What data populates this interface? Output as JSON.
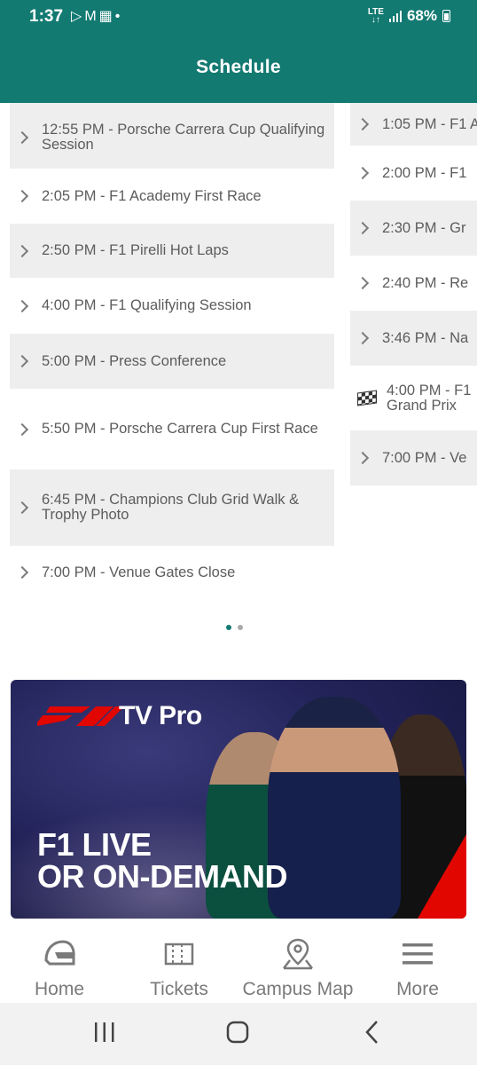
{
  "status_bar": {
    "time": "1:37",
    "notification_icons": [
      "play-store-icon",
      "gmail-icon",
      "calendar-icon",
      "dot-icon"
    ],
    "network": "LTE",
    "battery": "68%"
  },
  "header": {
    "title": "Schedule"
  },
  "schedule_pages": [
    {
      "rows": [
        {
          "text": "12:55 PM - Porsche Carrera Cup Qualifying Session",
          "shaded": true,
          "icon": "chevron-right-icon"
        },
        {
          "text": "2:05 PM - F1 Academy First Race",
          "shaded": false,
          "icon": "chevron-right-icon"
        },
        {
          "text": "2:50 PM - F1 Pirelli Hot Laps",
          "shaded": true,
          "icon": "chevron-right-icon"
        },
        {
          "text": "4:00 PM - F1 Qualifying Session",
          "shaded": false,
          "icon": "chevron-right-icon"
        },
        {
          "text": "5:00 PM - Press Conference",
          "shaded": true,
          "icon": "chevron-right-icon"
        },
        {
          "text": "5:50 PM - Porsche Carrera Cup First Race",
          "shaded": false,
          "icon": "chevron-right-icon"
        },
        {
          "text": "6:45 PM - Champions Club Grid Walk & Trophy Photo",
          "shaded": true,
          "icon": "chevron-right-icon"
        },
        {
          "text": "7:00 PM - Venue Gates Close",
          "shaded": false,
          "icon": "chevron-right-icon"
        }
      ]
    },
    {
      "rows": [
        {
          "text": "1:05 PM - F1 A",
          "shaded": true,
          "icon": "chevron-right-icon"
        },
        {
          "text": "2:00 PM - F1",
          "shaded": false,
          "icon": "chevron-right-icon"
        },
        {
          "text": "2:30 PM - Gr",
          "shaded": true,
          "icon": "chevron-right-icon"
        },
        {
          "text": "2:40 PM - Re",
          "shaded": false,
          "icon": "chevron-right-icon"
        },
        {
          "text": "3:46 PM - Na",
          "shaded": true,
          "icon": "chevron-right-icon"
        },
        {
          "text": "4:00 PM - F1\nGrand Prix",
          "shaded": false,
          "icon": "checkered-flag-icon"
        },
        {
          "text": "7:00 PM - Ve",
          "shaded": true,
          "icon": "chevron-right-icon"
        }
      ]
    }
  ],
  "pager": {
    "page_count": 2,
    "active_page": 1
  },
  "banner": {
    "brand_text": "TV Pro",
    "headline": "F1 LIVE\nOR ON-DEMAND"
  },
  "bottom_nav": [
    {
      "label": "Home",
      "icon": "helmet-icon"
    },
    {
      "label": "Tickets",
      "icon": "ticket-icon"
    },
    {
      "label": "Campus Map",
      "icon": "map-pin-icon"
    },
    {
      "label": "More",
      "icon": "hamburger-menu-icon"
    }
  ],
  "system_nav": [
    "recent-apps-icon",
    "home-circle-icon",
    "back-icon"
  ],
  "colors": {
    "accent": "#137a72",
    "row_shade": "#eeeeee",
    "text": "#5c5c5c",
    "f1_red": "#e10600"
  }
}
